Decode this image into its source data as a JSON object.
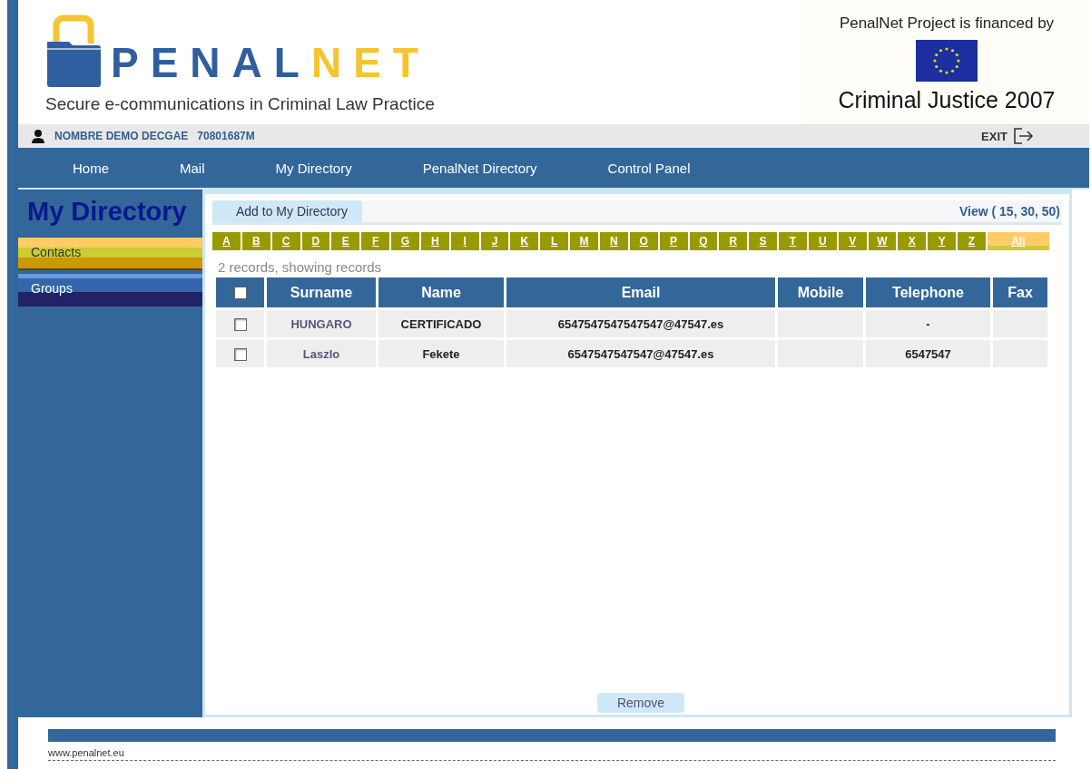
{
  "header": {
    "logo_primary": "PENAL",
    "logo_accent": "NET",
    "tagline": "Secure e-communications in Criminal Law Practice",
    "sponsor_text": "PenalNet Project is financed by",
    "programme": "Criminal Justice 2007"
  },
  "user_bar": {
    "user_name": "NOMBRE DEMO DECGAE",
    "user_id": "70801687M",
    "exit_label": "EXIT"
  },
  "nav": [
    {
      "label": "Home"
    },
    {
      "label": "Mail"
    },
    {
      "label": "My Directory"
    },
    {
      "label": "PenalNet Directory"
    },
    {
      "label": "Control Panel"
    }
  ],
  "sidebar": {
    "title": "My Directory",
    "items": [
      {
        "label": "Contacts",
        "selected": true
      },
      {
        "label": "Groups",
        "selected": false
      }
    ]
  },
  "toolbar": {
    "add_button": "Add to My Directory",
    "view_options": "View ( 15, 30, 50)"
  },
  "letters": [
    {
      "label": "A",
      "selected": false
    },
    {
      "label": "B",
      "selected": false
    },
    {
      "label": "C",
      "selected": false
    },
    {
      "label": "D",
      "selected": false
    },
    {
      "label": "E",
      "selected": false
    },
    {
      "label": "F",
      "selected": false
    },
    {
      "label": "G",
      "selected": false
    },
    {
      "label": "H",
      "selected": false
    },
    {
      "label": "I",
      "selected": false
    },
    {
      "label": "J",
      "selected": false
    },
    {
      "label": "K",
      "selected": false
    },
    {
      "label": "L",
      "selected": false
    },
    {
      "label": "M",
      "selected": false
    },
    {
      "label": "N",
      "selected": false
    },
    {
      "label": "O",
      "selected": false
    },
    {
      "label": "P",
      "selected": false
    },
    {
      "label": "Q",
      "selected": false
    },
    {
      "label": "R",
      "selected": false
    },
    {
      "label": "S",
      "selected": false
    },
    {
      "label": "T",
      "selected": false
    },
    {
      "label": "U",
      "selected": false
    },
    {
      "label": "V",
      "selected": false
    },
    {
      "label": "W",
      "selected": false
    },
    {
      "label": "X",
      "selected": false
    },
    {
      "label": "Y",
      "selected": false
    },
    {
      "label": "Z",
      "selected": false
    },
    {
      "label": "All",
      "selected": true
    }
  ],
  "records_summary": "2 records, showing records",
  "table": {
    "select_all_checked": false,
    "columns": [
      "Surname",
      "Name",
      "Email",
      "Mobile",
      "Telephone",
      "Fax"
    ],
    "rows": [
      {
        "checked": false,
        "surname": "HUNGARO",
        "name": "CERTIFICADO",
        "email": "6547547547547547@47547.es",
        "telephone": "-"
      },
      {
        "checked": false,
        "surname": "Laszlo",
        "name": "Fekete",
        "email": "6547547547547@47547.es",
        "telephone": "6547547"
      }
    ]
  },
  "remove_button": "Remove",
  "footer": {
    "url": "www.penalnet.eu"
  }
}
